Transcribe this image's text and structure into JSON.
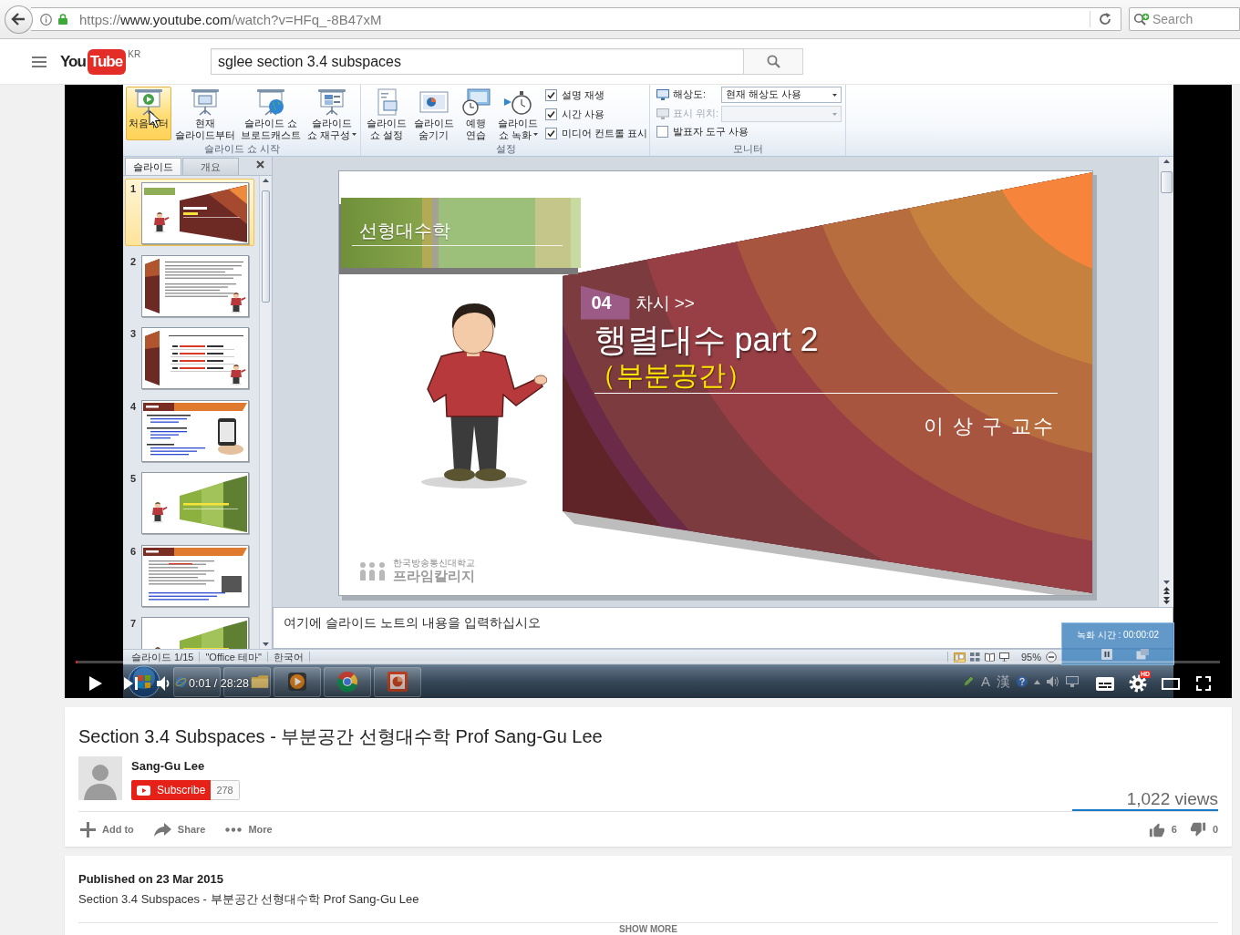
{
  "browser": {
    "url": {
      "scheme": "https://",
      "host": "www.youtube.com",
      "path": "/watch?v=HFq_-8B47xM"
    },
    "search": {
      "placeholder": "Search"
    }
  },
  "header": {
    "logo": {
      "you": "You",
      "tube": "Tube",
      "region": "KR"
    },
    "search": {
      "value": "sglee section 3.4 subspaces"
    }
  },
  "video": {
    "ribbon": {
      "groups": [
        {
          "label": "슬라이드 쇼 시작",
          "buttons": [
            {
              "lines": [
                "처음부터"
              ],
              "highlighted": true,
              "menu": false
            },
            {
              "lines": [
                "현재",
                "슬라이드부터"
              ],
              "highlighted": false,
              "menu": false
            },
            {
              "lines": [
                "슬라이드 쇼",
                "브로드캐스트"
              ],
              "highlighted": false,
              "menu": false
            },
            {
              "lines": [
                "슬라이드",
                "쇼 재구성"
              ],
              "highlighted": false,
              "menu": true
            }
          ]
        },
        {
          "label": "설정",
          "buttons": [
            {
              "lines": [
                "슬라이드",
                "쇼 설정"
              ],
              "highlighted": false,
              "menu": false
            },
            {
              "lines": [
                "슬라이드",
                "숨기기"
              ],
              "highlighted": false,
              "menu": false
            },
            {
              "lines": [
                "예행",
                "연습"
              ],
              "highlighted": false,
              "menu": false
            },
            {
              "lines": [
                "슬라이드",
                "쇼 녹화"
              ],
              "highlighted": false,
              "menu": true
            }
          ],
          "checks": [
            {
              "label": "설명 재생",
              "checked": true
            },
            {
              "label": "시간 사용",
              "checked": true
            },
            {
              "label": "미디어 컨트롤 표시",
              "checked": true
            }
          ]
        },
        {
          "label": "모니터",
          "fields": [
            {
              "label": "해상도:",
              "value": "현재 해상도 사용",
              "disabled": false
            },
            {
              "label": "표시 위치:",
              "disabled": true
            }
          ],
          "checks": [
            {
              "label": "발표자 도구 사용",
              "checked": false
            }
          ]
        }
      ]
    },
    "slide_pane": {
      "tabs": [
        {
          "label": "슬라이드",
          "selected": true
        },
        {
          "label": "개요",
          "selected": false
        }
      ],
      "slides": [
        {
          "number": "1",
          "kind": "brown-title",
          "selected": true
        },
        {
          "number": "2",
          "kind": "bar-text",
          "selected": false
        },
        {
          "number": "3",
          "kind": "bar-list",
          "selected": false
        },
        {
          "number": "4",
          "kind": "header-links",
          "selected": false
        },
        {
          "number": "5",
          "kind": "green-title",
          "selected": false
        },
        {
          "number": "6",
          "kind": "header-text",
          "selected": false
        },
        {
          "number": "7",
          "kind": "green-title",
          "selected": false
        }
      ]
    },
    "slide": {
      "course": "선형대수학",
      "session_number": "04",
      "session_label": "차시 >>",
      "title": "행렬대수 part 2",
      "subtitle": "（부분공간）",
      "presenter": "이 상 구 교수",
      "logo": {
        "institution": "한국방송통신대학교",
        "name": "프라임칼리지"
      }
    },
    "notes": {
      "placeholder": "여기에 슬라이드 노트의 내용을 입력하십시오"
    },
    "status_bar": {
      "slide": "슬라이드 1/15",
      "theme": "\"Office 테마\"",
      "language": "한국어",
      "zoom": "95%"
    },
    "recording": {
      "label": "녹화 시간 : 00:00:02"
    },
    "taskbar": {
      "ime": [
        "A",
        "漢"
      ]
    },
    "player": {
      "progress": {
        "level": 0.001
      },
      "time": "0:01 / 28:28",
      "quality": "HD"
    }
  },
  "info": {
    "title": "Section 3.4 Subspaces - 부분공간 선형대수학 Prof Sang-Gu Lee",
    "channel": "Sang-Gu Lee",
    "subscribe": "Subscribe",
    "subscribers": "278",
    "views": "1,022 views",
    "sentiment": {
      "level": 1
    },
    "actions": [
      {
        "label": "Add to"
      },
      {
        "label": "Share"
      },
      {
        "label": "More"
      }
    ],
    "likes": "6",
    "dislikes": "0"
  },
  "description": {
    "published": "Published on 23 Mar 2015",
    "text": "Section 3.4 Subspaces - 부분공간 선형대수학 Prof Sang-Gu Lee",
    "show_more": "SHOW MORE"
  }
}
